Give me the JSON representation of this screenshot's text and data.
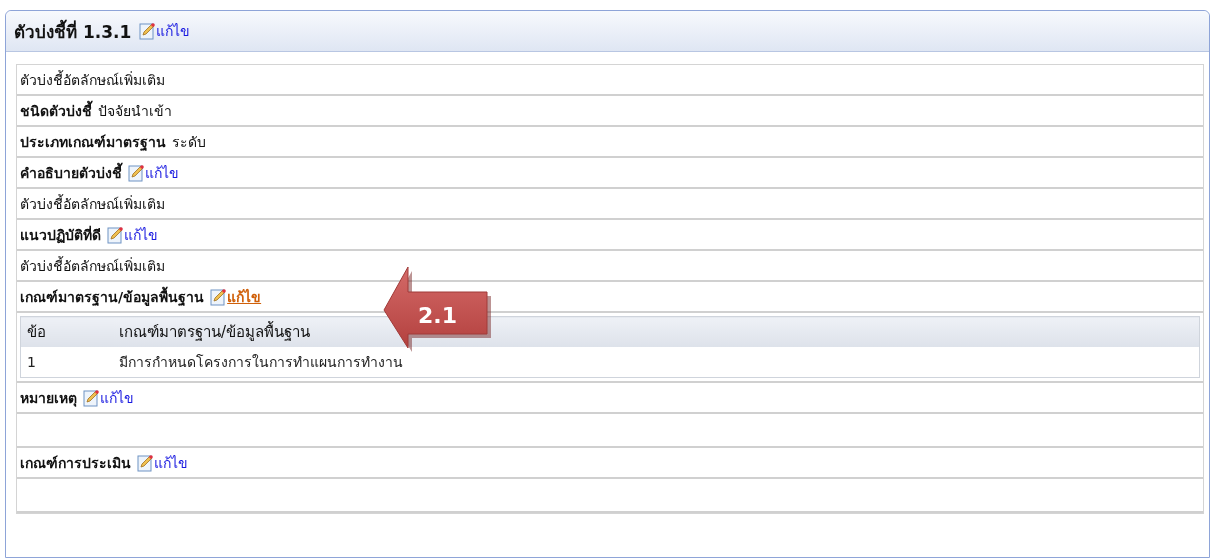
{
  "panel": {
    "title": "ตัวบ่งชี้ที่ 1.3.1",
    "edit": {
      "label": "แก้ไข",
      "highlighted": false
    }
  },
  "rows": [
    {
      "kind": "text",
      "text": "ตัวบ่งชี้อัตลักษณ์เพิ่มเติม"
    },
    {
      "kind": "label_value",
      "label": "ชนิดตัวบ่งชี้",
      "value": "ปัจจัยนำเข้า"
    },
    {
      "kind": "label_value",
      "label": "ประเภทเกณฑ์มาตรฐาน",
      "value": "ระดับ"
    },
    {
      "kind": "label_edit",
      "label": "คำอธิบายตัวบ่งชี้",
      "edit": {
        "label": "แก้ไข",
        "highlighted": false
      }
    },
    {
      "kind": "text",
      "text": "ตัวบ่งชี้อัตลักษณ์เพิ่มเติม"
    },
    {
      "kind": "label_edit",
      "label": "แนวปฏิบัติที่ดี",
      "edit": {
        "label": "แก้ไข",
        "highlighted": false
      }
    },
    {
      "kind": "text",
      "text": "ตัวบ่งชี้อัตลักษณ์เพิ่มเติม"
    },
    {
      "kind": "label_edit",
      "label": "เกณฑ์มาตรฐาน/ข้อมูลพื้นฐาน",
      "edit": {
        "label": "แก้ไข",
        "highlighted": true
      }
    },
    {
      "kind": "table",
      "columns": [
        "ข้อ",
        "เกณฑ์มาตรฐาน/ข้อมูลพื้นฐาน"
      ],
      "rows": [
        [
          "1",
          "มีการกำหนดโครงการในการทำแผนการทำงาน"
        ]
      ]
    },
    {
      "kind": "label_edit",
      "label": "หมายเหตุ",
      "edit": {
        "label": "แก้ไข",
        "highlighted": false
      }
    },
    {
      "kind": "empty"
    },
    {
      "kind": "label_edit",
      "label": "เกณฑ์การประเมิน",
      "edit": {
        "label": "แก้ไข",
        "highlighted": false
      }
    },
    {
      "kind": "empty"
    }
  ],
  "callout": {
    "text": "2.1"
  }
}
